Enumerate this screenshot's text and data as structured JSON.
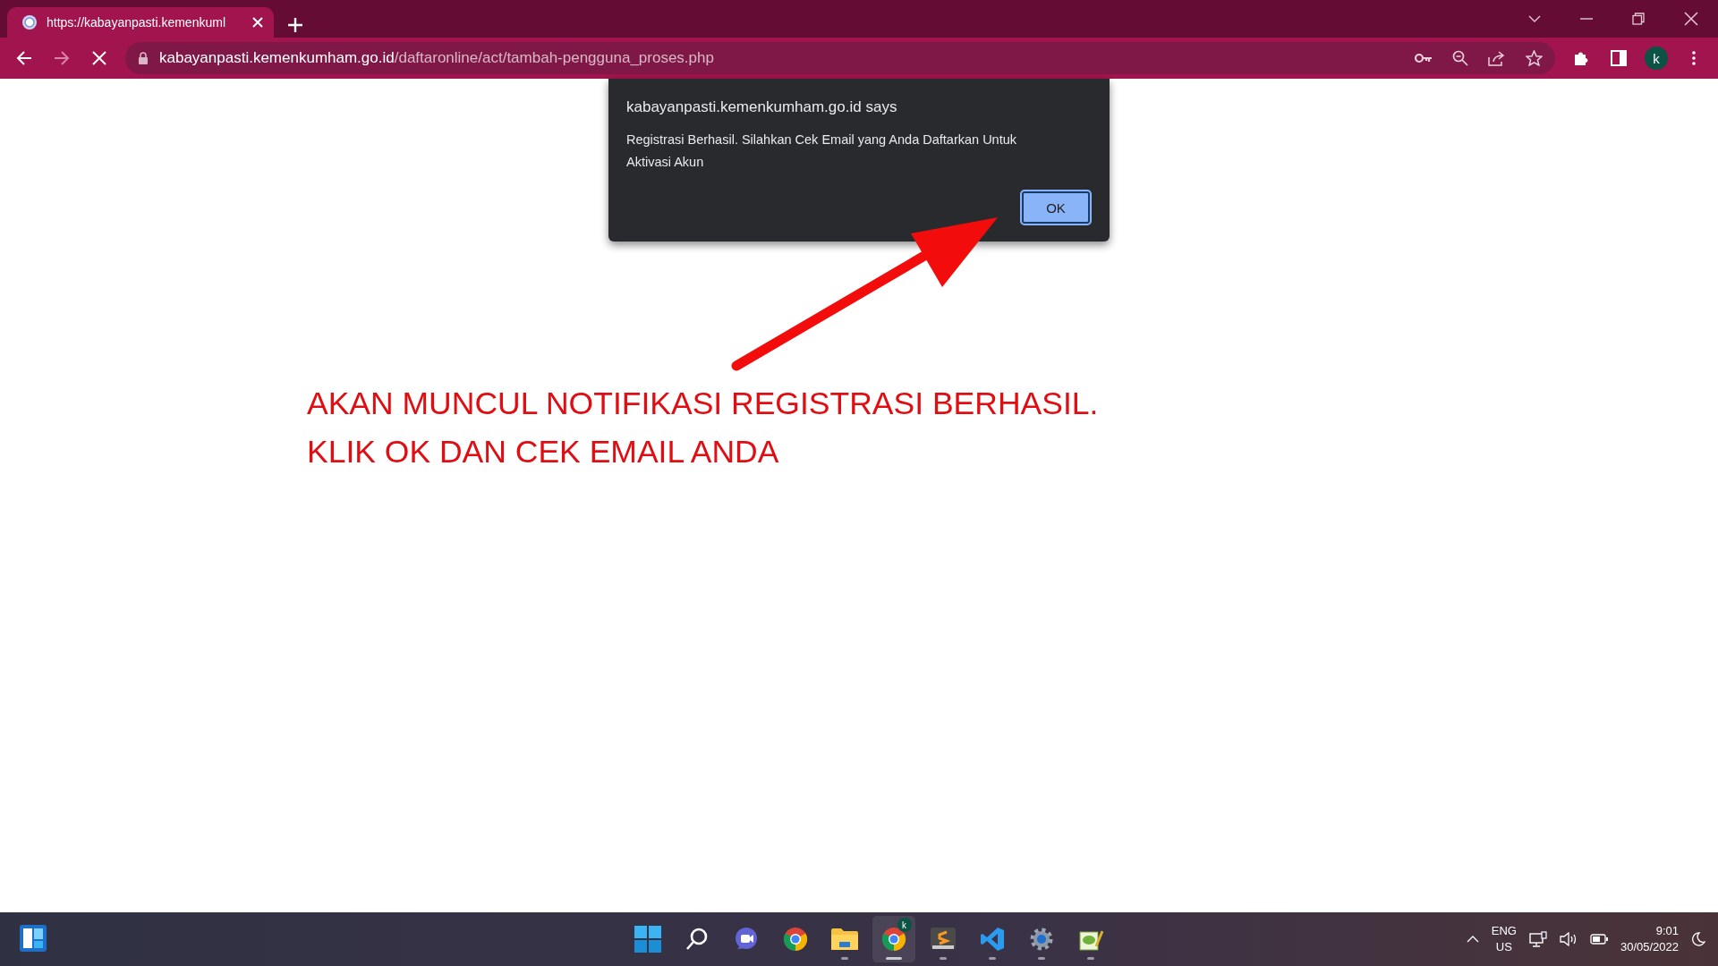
{
  "browser": {
    "tab": {
      "title": "https://kabayanpasti.kemenkuml",
      "selected": true
    },
    "address": {
      "domain": "kabayanpasti.kemenkumham.go.id",
      "path": "/daftaronline/act/tambah-pengguna_proses.php"
    },
    "profile": "k",
    "loading": true
  },
  "dialog": {
    "title": "kabayanpasti.kemenkumham.go.id says",
    "message": "Registrasi Berhasil. Silahkan Cek Email yang Anda Daftarkan Untuk Aktivasi Akun",
    "button": "OK"
  },
  "annotation": {
    "lines": [
      "AKAN MUNCUL NOTIFIKASI REGISTRASI BERHASIL.",
      "KLIK OK DAN CEK EMAIL ANDA"
    ]
  },
  "taskbar": {
    "apps": [
      {
        "kind": "start",
        "running": false,
        "selected": false
      },
      {
        "kind": "search",
        "running": false,
        "selected": false
      },
      {
        "kind": "meet",
        "running": false,
        "selected": false
      },
      {
        "kind": "chrome",
        "running": false,
        "selected": false
      },
      {
        "kind": "folder",
        "running": true,
        "selected": false
      },
      {
        "kind": "chrome-profile",
        "running": true,
        "selected": true,
        "badge": "k"
      },
      {
        "kind": "sublime",
        "running": true,
        "selected": false
      },
      {
        "kind": "vscode",
        "running": true,
        "selected": false
      },
      {
        "kind": "settings",
        "running": true,
        "selected": false
      },
      {
        "kind": "notepad",
        "running": true,
        "selected": false
      }
    ],
    "language": [
      "ENG",
      "US"
    ],
    "time": "9:01",
    "date": "30/05/2022"
  }
}
